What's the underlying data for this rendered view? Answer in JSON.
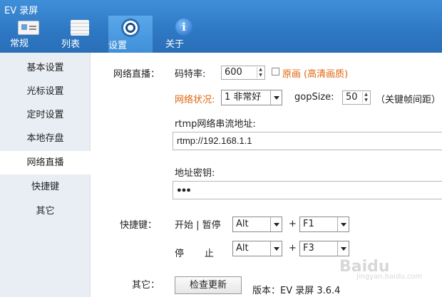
{
  "window": {
    "title": "EV 录屏"
  },
  "toolbar": {
    "general": "常规",
    "list": "列表",
    "settings": "设置",
    "about": "关于"
  },
  "sidebar": {
    "items": [
      "基本设置",
      "光标设置",
      "定时设置",
      "本地存盘",
      "网络直播",
      "快捷键",
      "其它"
    ],
    "active_index": 4
  },
  "live": {
    "section_label": "网络直播：",
    "bitrate_label": "码特率:",
    "bitrate_value": "600",
    "original_label": "原画",
    "original_hint": "(高清画质)",
    "network_label": "网络状况:",
    "network_value": "1  非常好",
    "gop_label": "gopSize:",
    "gop_value": "50",
    "gop_hint": "（关键帧间距）",
    "url_label": "rtmp网络串流地址:",
    "url_value": "rtmp://192.168.1.1",
    "key_label": "地址密钥:",
    "key_value": "●●●"
  },
  "hotkeys": {
    "section_label": "快捷键：",
    "start_label": "开始 | 暂停",
    "start_mod": "Alt",
    "start_key": "F1",
    "stop_label": "停       止",
    "stop_mod": "Alt",
    "stop_key": "F3",
    "plus": "+"
  },
  "other": {
    "section_label": "其它：",
    "check_update": "检查更新",
    "version": "版本：EV 录屏 3.6.4"
  },
  "watermark": {
    "text": "Baidu",
    "sub": "jingyan.baidu.com"
  },
  "colors": {
    "toolbar": "#2e77c3",
    "accent": "#e0640c",
    "sidebar": "#e9eef4"
  }
}
